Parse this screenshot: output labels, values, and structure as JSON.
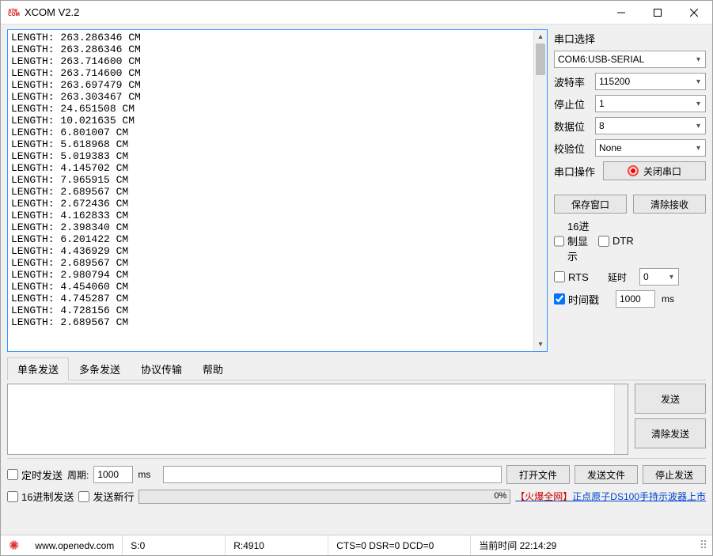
{
  "titlebar": {
    "icon_text": "ATK\nCOM",
    "title": "XCOM V2.2"
  },
  "terminal_lines": [
    "LENGTH: 263.286346 CM",
    "LENGTH: 263.286346 CM",
    "LENGTH: 263.714600 CM",
    "LENGTH: 263.714600 CM",
    "LENGTH: 263.697479 CM",
    "LENGTH: 263.303467 CM",
    "LENGTH: 24.651508 CM",
    "LENGTH: 10.021635 CM",
    "LENGTH: 6.801007 CM",
    "LENGTH: 5.618968 CM",
    "LENGTH: 5.019383 CM",
    "LENGTH: 4.145702 CM",
    "LENGTH: 7.965915 CM",
    "LENGTH: 2.689567 CM",
    "LENGTH: 2.672436 CM",
    "LENGTH: 4.162833 CM",
    "LENGTH: 2.398340 CM",
    "LENGTH: 6.201422 CM",
    "LENGTH: 4.436929 CM",
    "LENGTH: 2.689567 CM",
    "LENGTH: 2.980794 CM",
    "LENGTH: 4.454060 CM",
    "LENGTH: 4.745287 CM",
    "LENGTH: 4.728156 CM",
    "LENGTH: 2.689567 CM"
  ],
  "side": {
    "port_section": "串口选择",
    "port_value": "COM6:USB-SERIAL",
    "baud_label": "波特率",
    "baud_value": "115200",
    "stop_label": "停止位",
    "stop_value": "1",
    "data_label": "数据位",
    "data_value": "8",
    "parity_label": "校验位",
    "parity_value": "None",
    "op_label": "串口操作",
    "op_button": "关闭串口",
    "save_btn": "保存窗口",
    "clear_btn": "清除接收",
    "hex_disp": "16进制显示",
    "dtr": "DTR",
    "rts": "RTS",
    "delay_label": "延时",
    "delay_value": "0",
    "timestamp": "时间戳",
    "timestamp_value": "1000",
    "ms": "ms"
  },
  "tabs": [
    "单条发送",
    "多条发送",
    "协议传输",
    "帮助"
  ],
  "active_tab": 0,
  "send_buttons": {
    "send": "发送",
    "clear_send": "清除发送"
  },
  "bottom": {
    "timed_send": "定时发送",
    "period_label": "周期:",
    "period_value": "1000",
    "ms": "ms",
    "open_file": "打开文件",
    "send_file": "发送文件",
    "stop_send": "停止发送",
    "hex_send": "16进制发送",
    "send_newline": "发送新行",
    "progress_pct": "0%",
    "promo_hot": "【火爆全网】",
    "promo_rest": "正点原子DS100手持示波器上市"
  },
  "status": {
    "url": "www.openedv.com",
    "s": "S:0",
    "r": "R:4910",
    "signals": "CTS=0 DSR=0 DCD=0",
    "time_label": "当前时间",
    "time_value": "22:14:29"
  }
}
